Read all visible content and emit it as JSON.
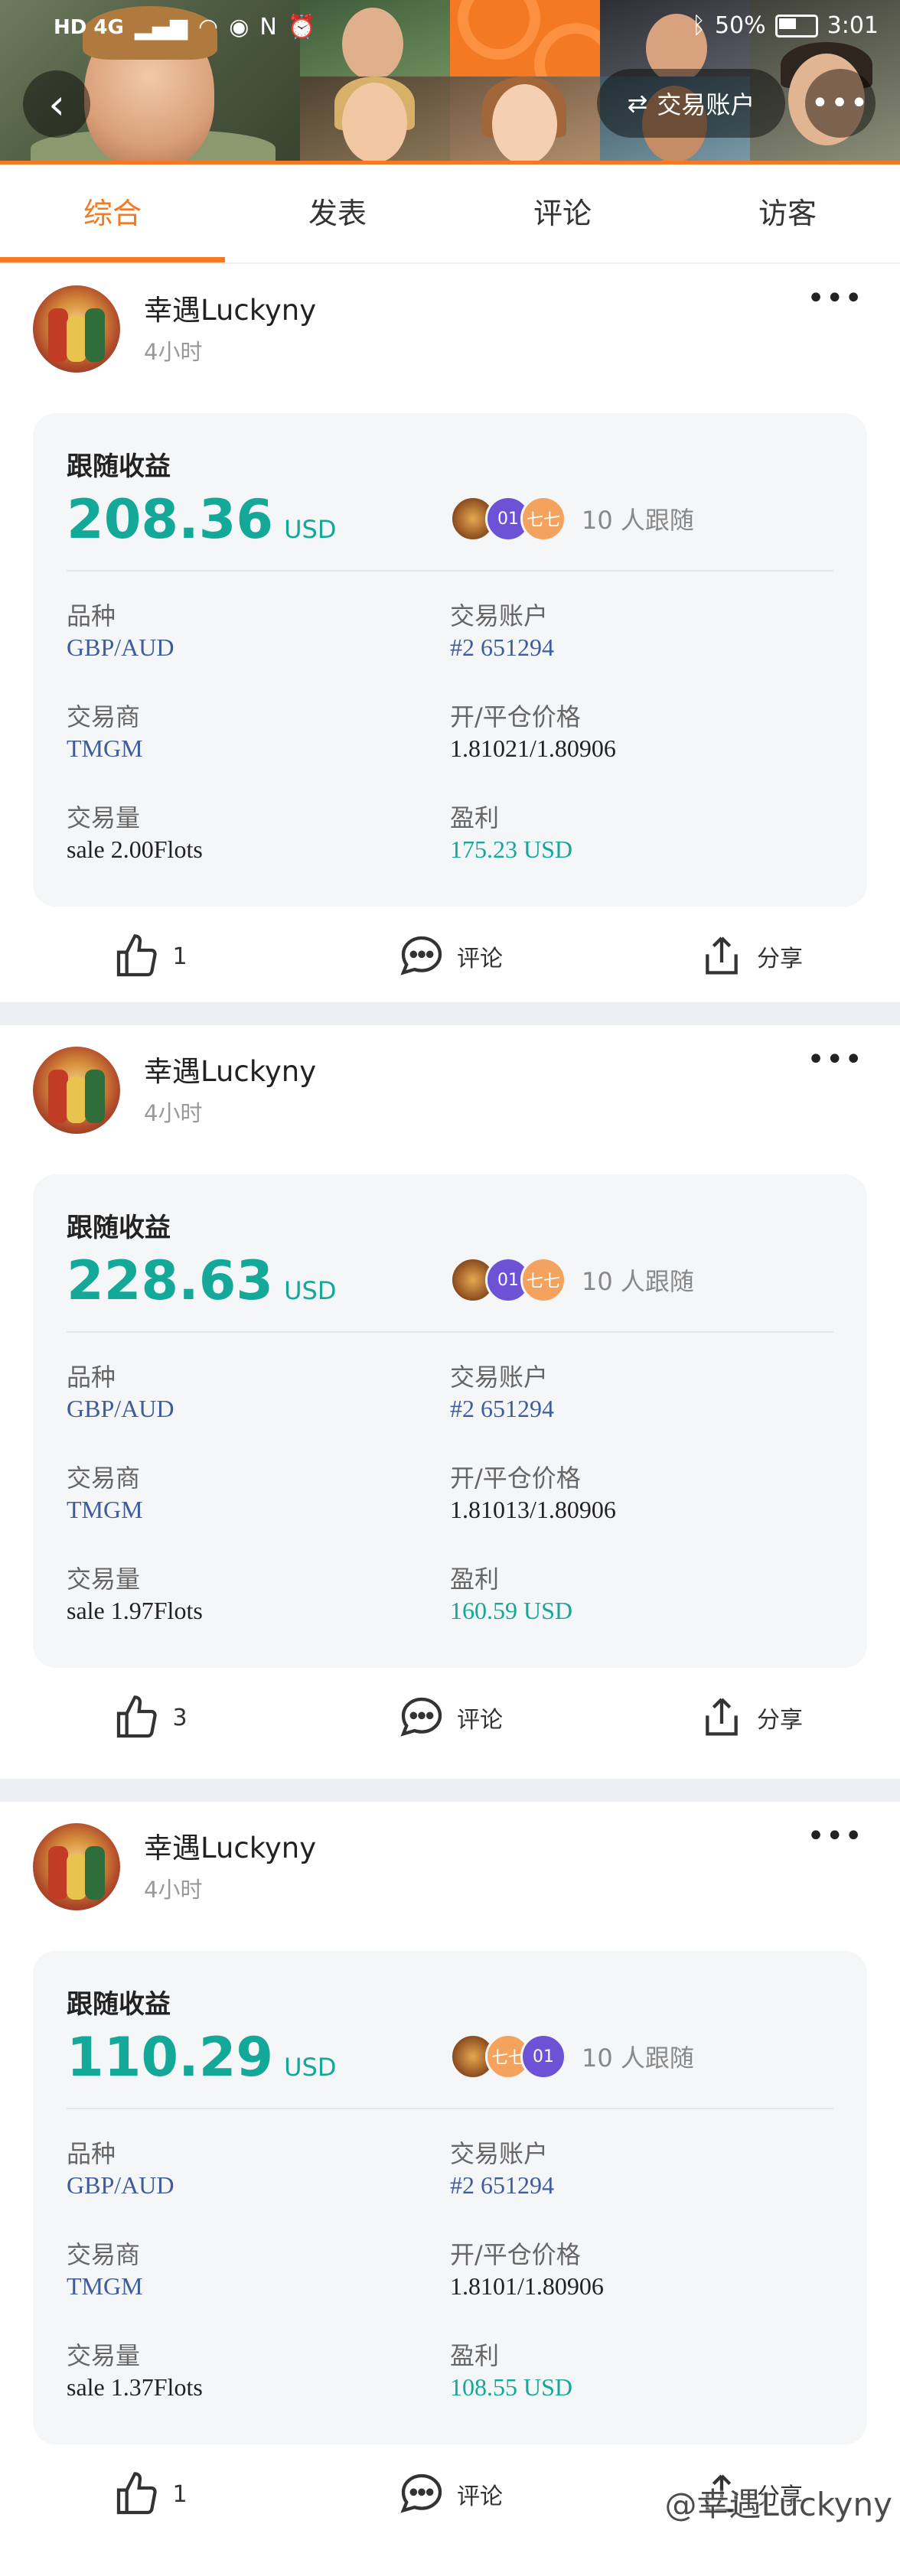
{
  "statusbar": {
    "left_icons": "HD 4G",
    "battery": "50%",
    "time": "3:01"
  },
  "header": {
    "account_button": "交易账户",
    "more": "•••",
    "back": "‹"
  },
  "tabs": [
    {
      "label": "综合",
      "active": true
    },
    {
      "label": "发表",
      "active": false
    },
    {
      "label": "评论",
      "active": false
    },
    {
      "label": "访客",
      "active": false
    }
  ],
  "posts": [
    {
      "author": "幸遇Luckyny",
      "time": "4小时",
      "card": {
        "title": "跟随收益",
        "amount": "208.36",
        "currency": "USD",
        "follower_avatars": [
          {
            "text": ""
          },
          {
            "text": "01"
          },
          {
            "text": "七七"
          }
        ],
        "followers_text": "10 人跟随",
        "fields": {
          "product_label": "品种",
          "product": "GBP/AUD",
          "account_label": "交易账户",
          "account": "#2 651294",
          "broker_label": "交易商",
          "broker": "TMGM",
          "price_label": "开/平仓价格",
          "price": "1.81021/1.80906",
          "volume_label": "交易量",
          "volume": "sale 2.00Flots",
          "profit_label": "盈利",
          "profit": "175.23 USD"
        }
      },
      "likes": "1",
      "comment_label": "评论",
      "share_label": "分享"
    },
    {
      "author": "幸遇Luckyny",
      "time": "4小时",
      "card": {
        "title": "跟随收益",
        "amount": "228.63",
        "currency": "USD",
        "follower_avatars": [
          {
            "text": ""
          },
          {
            "text": "01"
          },
          {
            "text": "七七"
          }
        ],
        "followers_text": "10 人跟随",
        "fields": {
          "product_label": "品种",
          "product": "GBP/AUD",
          "account_label": "交易账户",
          "account": "#2 651294",
          "broker_label": "交易商",
          "broker": "TMGM",
          "price_label": "开/平仓价格",
          "price": "1.81013/1.80906",
          "volume_label": "交易量",
          "volume": "sale 1.97Flots",
          "profit_label": "盈利",
          "profit": "160.59 USD"
        }
      },
      "likes": "3",
      "comment_label": "评论",
      "share_label": "分享"
    },
    {
      "author": "幸遇Luckyny",
      "time": "4小时",
      "card": {
        "title": "跟随收益",
        "amount": "110.29",
        "currency": "USD",
        "follower_avatars": [
          {
            "text": ""
          },
          {
            "text": "七七"
          },
          {
            "text": "01"
          }
        ],
        "followers_text": "10 人跟随",
        "fields": {
          "product_label": "品种",
          "product": "GBP/AUD",
          "account_label": "交易账户",
          "account": "#2 651294",
          "broker_label": "交易商",
          "broker": "TMGM",
          "price_label": "开/平仓价格",
          "price": "1.8101/1.80906",
          "volume_label": "交易量",
          "volume": "sale 1.37Flots",
          "profit_label": "盈利",
          "profit": "108.55 USD"
        }
      },
      "likes": "1",
      "comment_label": "评论",
      "share_label": "分享"
    }
  ],
  "watermark": "@幸遇Luckyny",
  "colors": {
    "accent": "#f37a22",
    "profit_green": "#14a898",
    "link_blue": "#3f5c9c"
  }
}
